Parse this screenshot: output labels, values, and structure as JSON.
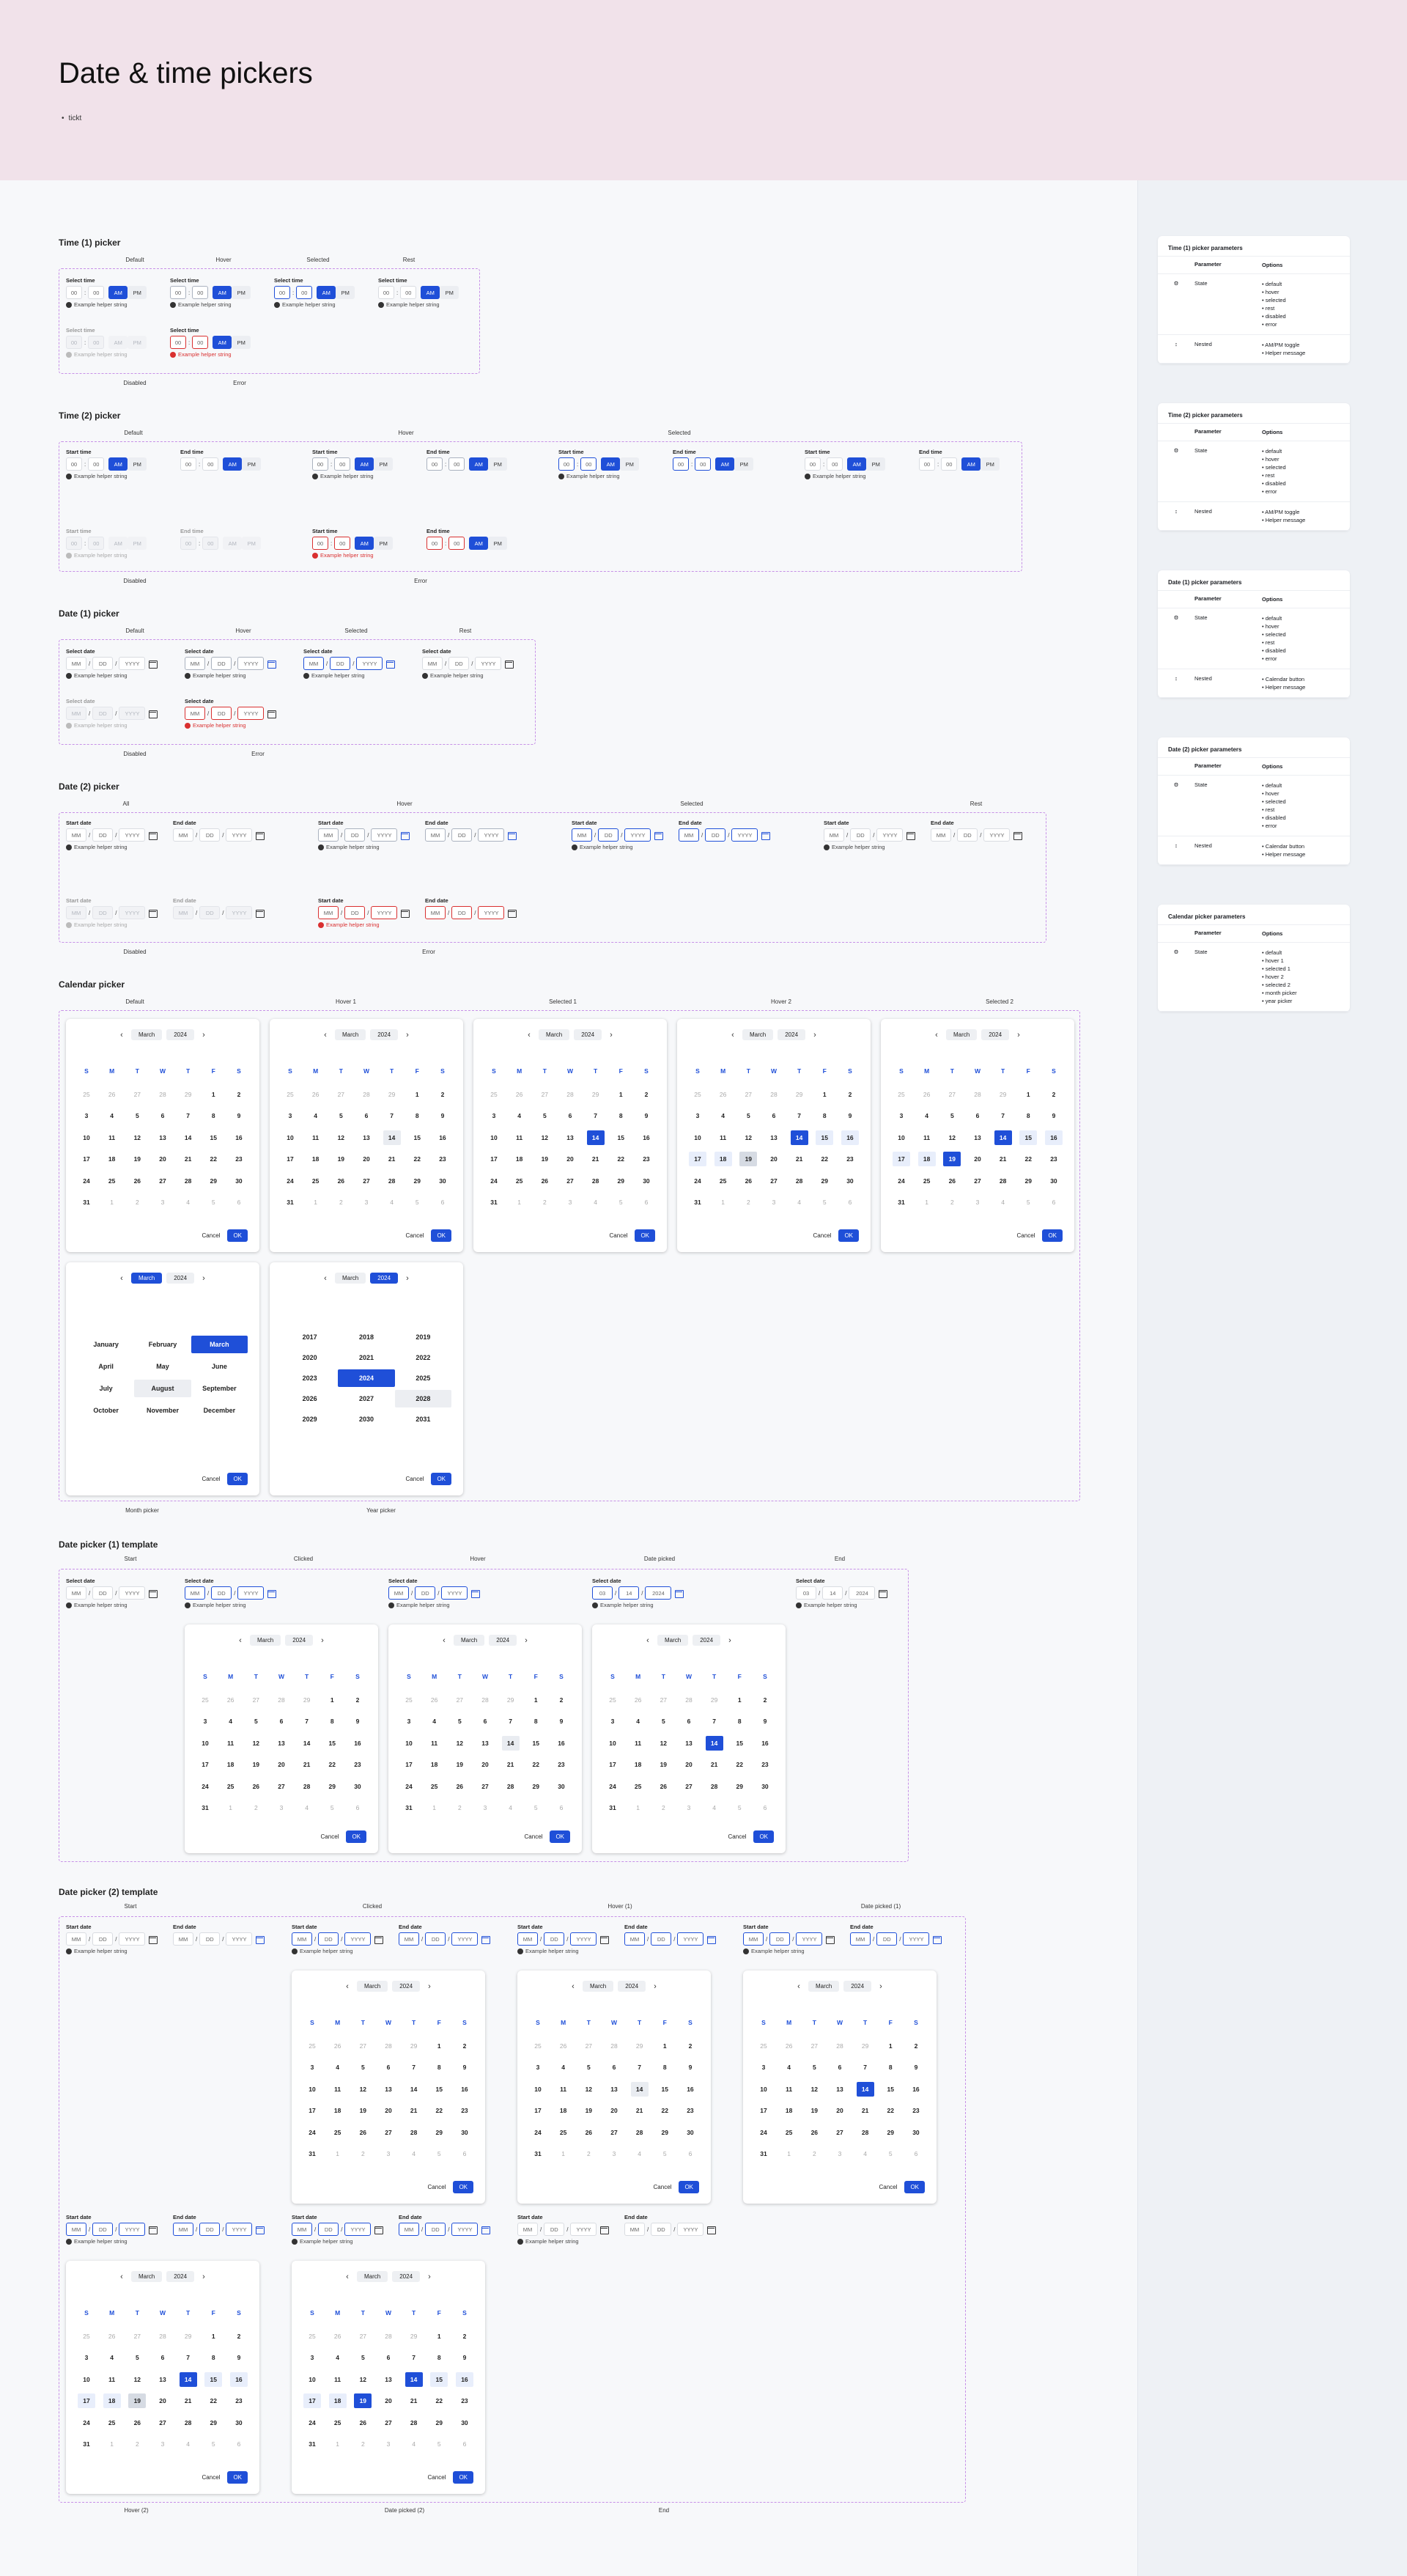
{
  "header": {
    "title": "Date & time pickers",
    "tag": "tickt"
  },
  "labels": {
    "select_time": "Select time",
    "start_time": "Start time",
    "end_time": "End time",
    "select_date": "Select date",
    "start_date": "Start date",
    "end_date": "End date",
    "helper": "Example helper string",
    "t00": "00",
    "am": "AM",
    "pm": "PM",
    "mm": "MM",
    "dd": "DD",
    "yyyy": "YYYY",
    "d03": "03",
    "d14": "14",
    "d2024": "2024",
    "cancel": "Cancel",
    "ok": "OK",
    "month": "March",
    "year": "2024"
  },
  "sections": {
    "time1": {
      "title": "Time (1) picker",
      "states": [
        "Default",
        "Hover",
        "Selected",
        "Rest"
      ],
      "states2": [
        "Disabled",
        "Error"
      ]
    },
    "time2": {
      "title": "Time (2) picker",
      "states": [
        "Default",
        "Hover",
        "Selected"
      ],
      "states2": [
        "Disabled",
        "Error"
      ]
    },
    "date1": {
      "title": "Date (1) picker",
      "states": [
        "Default",
        "Hover",
        "Selected",
        "Rest"
      ],
      "states2": [
        "Disabled",
        "Error"
      ]
    },
    "date2": {
      "title": "Date (2) picker",
      "states": [
        "All",
        "Hover",
        "Selected",
        "Rest"
      ],
      "states2": [
        "Disabled",
        "Error"
      ]
    },
    "calendar": {
      "title": "Calendar picker",
      "states": [
        "Default",
        "Hover 1",
        "Selected 1",
        "Hover 2",
        "Selected 2"
      ],
      "states2": [
        "Month picker",
        "Year picker"
      ]
    },
    "tpl1": {
      "title": "Date picker (1) template",
      "states": [
        "Start",
        "Clicked",
        "Hover",
        "Date picked",
        "End"
      ]
    },
    "tpl2": {
      "title": "Date picker (2) template",
      "states": [
        "Start",
        "Clicked",
        "Hover (1)",
        "Date picked (1)"
      ],
      "states2": [
        "Hover (2)",
        "Date picked (2)",
        "End"
      ]
    }
  },
  "weekdays": [
    "S",
    "M",
    "T",
    "W",
    "T",
    "F",
    "S"
  ],
  "weeks": [
    [
      "25",
      "26",
      "27",
      "28",
      "29",
      "1",
      "2"
    ],
    [
      "3",
      "4",
      "5",
      "6",
      "7",
      "8",
      "9"
    ],
    [
      "10",
      "11",
      "12",
      "13",
      "14",
      "15",
      "16"
    ],
    [
      "17",
      "18",
      "19",
      "20",
      "21",
      "22",
      "23"
    ],
    [
      "24",
      "25",
      "26",
      "27",
      "28",
      "29",
      "30"
    ],
    [
      "31",
      "1",
      "2",
      "3",
      "4",
      "5",
      "6"
    ]
  ],
  "months": [
    "January",
    "February",
    "March",
    "April",
    "May",
    "June",
    "July",
    "August",
    "September",
    "October",
    "November",
    "December"
  ],
  "years": [
    "2017",
    "2018",
    "2019",
    "2020",
    "2021",
    "2022",
    "2023",
    "2024",
    "2025",
    "2026",
    "2027",
    "2028",
    "2029",
    "2030",
    "2031"
  ],
  "params": {
    "title_suffix": "picker parameters",
    "col_param": "Parameter",
    "col_opts": "Options",
    "state": "State",
    "nested": "Nested",
    "cards": [
      {
        "title": "Time (1) picker parameters",
        "state": [
          "default",
          "hover",
          "selected",
          "rest",
          "disabled",
          "error"
        ],
        "nested": [
          "AM/PM toggle",
          "Helper message"
        ]
      },
      {
        "title": "Time (2) picker parameters",
        "state": [
          "default",
          "hover",
          "selected",
          "rest",
          "disabled",
          "error"
        ],
        "nested": [
          "AM/PM toggle",
          "Helper message"
        ]
      },
      {
        "title": "Date (1) picker parameters",
        "state": [
          "default",
          "hover",
          "selected",
          "rest",
          "disabled",
          "error"
        ],
        "nested": [
          "Calendar button",
          "Helper message"
        ]
      },
      {
        "title": "Date (2) picker parameters",
        "state": [
          "default",
          "hover",
          "selected",
          "rest",
          "disabled",
          "error"
        ],
        "nested": [
          "Calendar button",
          "Helper message"
        ]
      },
      {
        "title": "Calendar picker parameters",
        "state": [
          "default",
          "hover 1",
          "selected 1",
          "hover 2",
          "selected 2",
          "month picker",
          "year picker"
        ]
      }
    ]
  },
  "colors": {
    "accent": "#1f4fd8",
    "error": "#d93030",
    "frame": "#c791e7",
    "header_bg": "#f1e2ea"
  }
}
